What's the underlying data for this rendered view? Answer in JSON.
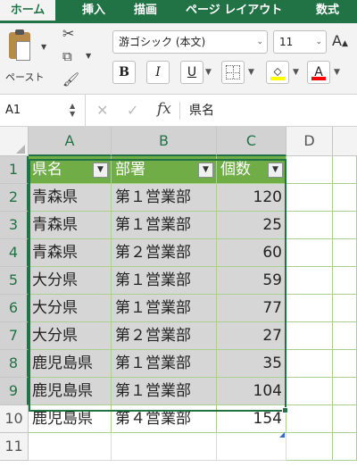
{
  "ribbon_tabs": [
    "ホーム",
    "挿入",
    "描画",
    "ページ レイアウト",
    "数式"
  ],
  "ribbon": {
    "paste_label": "ペースト",
    "font_name": "游ゴシック (本文)",
    "font_size": "11",
    "grow_font_glyph": "A",
    "bold_glyph": "B",
    "italic_glyph": "I",
    "underline_glyph": "U",
    "font_color_glyph": "A",
    "fill_color": "#ffff00",
    "font_color": "#ff0000",
    "icons": [
      "paste-icon",
      "cut-icon",
      "copy-icon",
      "format-painter-icon",
      "borders-icon",
      "fill-color-icon",
      "font-color-icon"
    ]
  },
  "formula_bar": {
    "name_box": "A1",
    "fx_label": "fx",
    "content": "県名"
  },
  "grid": {
    "columns": [
      "A",
      "B",
      "C",
      "D"
    ],
    "row_numbers": [
      "1",
      "2",
      "3",
      "4",
      "5",
      "6",
      "7",
      "8",
      "9",
      "10",
      "11"
    ],
    "header_row": [
      "県名",
      "部署",
      "個数"
    ],
    "rows": [
      [
        "青森県",
        "第１営業部",
        "120"
      ],
      [
        "青森県",
        "第１営業部",
        "25"
      ],
      [
        "青森県",
        "第２営業部",
        "60"
      ],
      [
        "大分県",
        "第１営業部",
        "59"
      ],
      [
        "大分県",
        "第１営業部",
        "77"
      ],
      [
        "大分県",
        "第２営業部",
        "27"
      ],
      [
        "鹿児島県",
        "第１営業部",
        "35"
      ],
      [
        "鹿児島県",
        "第１営業部",
        "104"
      ],
      [
        "鹿児島県",
        "第４営業部",
        "154"
      ]
    ],
    "table_header_color": "#70ad47",
    "selection_color": "#217346"
  }
}
